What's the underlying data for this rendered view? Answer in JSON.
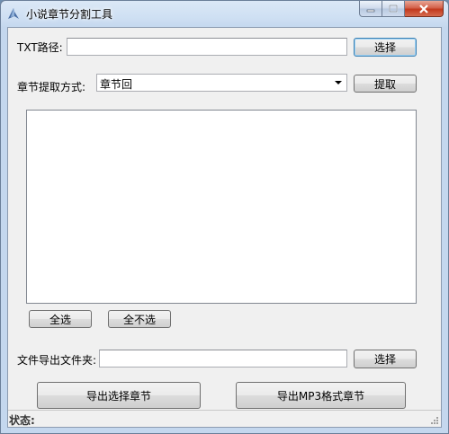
{
  "window": {
    "title": "小说章节分割工具"
  },
  "path_row": {
    "label": "TXT路径:",
    "value": "",
    "browse_label": "选择"
  },
  "method_row": {
    "label": "章节提取方式:",
    "selected": "章节回",
    "extract_label": "提取"
  },
  "chapter_list": {
    "items": []
  },
  "selection": {
    "select_all_label": "全选",
    "select_none_label": "全不选"
  },
  "export_row": {
    "label": "文件导出文件夹:",
    "value": "",
    "browse_label": "选择"
  },
  "actions": {
    "export_selected_label": "导出选择章节",
    "export_mp3_label": "导出MP3格式章节"
  },
  "status": {
    "label": "状态:"
  }
}
